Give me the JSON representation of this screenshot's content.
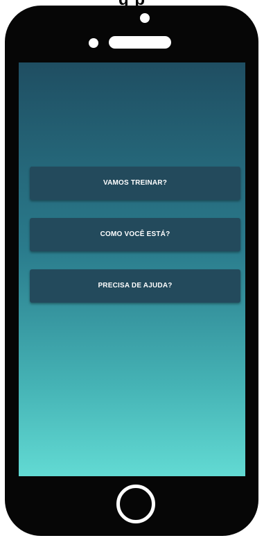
{
  "phone": {
    "screen_gradient": [
      "#1f4e62",
      "#62dad3"
    ],
    "button_color": "#234a5c",
    "home_button_icon": "home-button-ring"
  },
  "menu": {
    "buttons": [
      {
        "label": "VAMOS TREINAR?"
      },
      {
        "label": "COMO VOCÊ ESTÁ?"
      },
      {
        "label": "PRECISA DE AJUDA?"
      }
    ]
  }
}
